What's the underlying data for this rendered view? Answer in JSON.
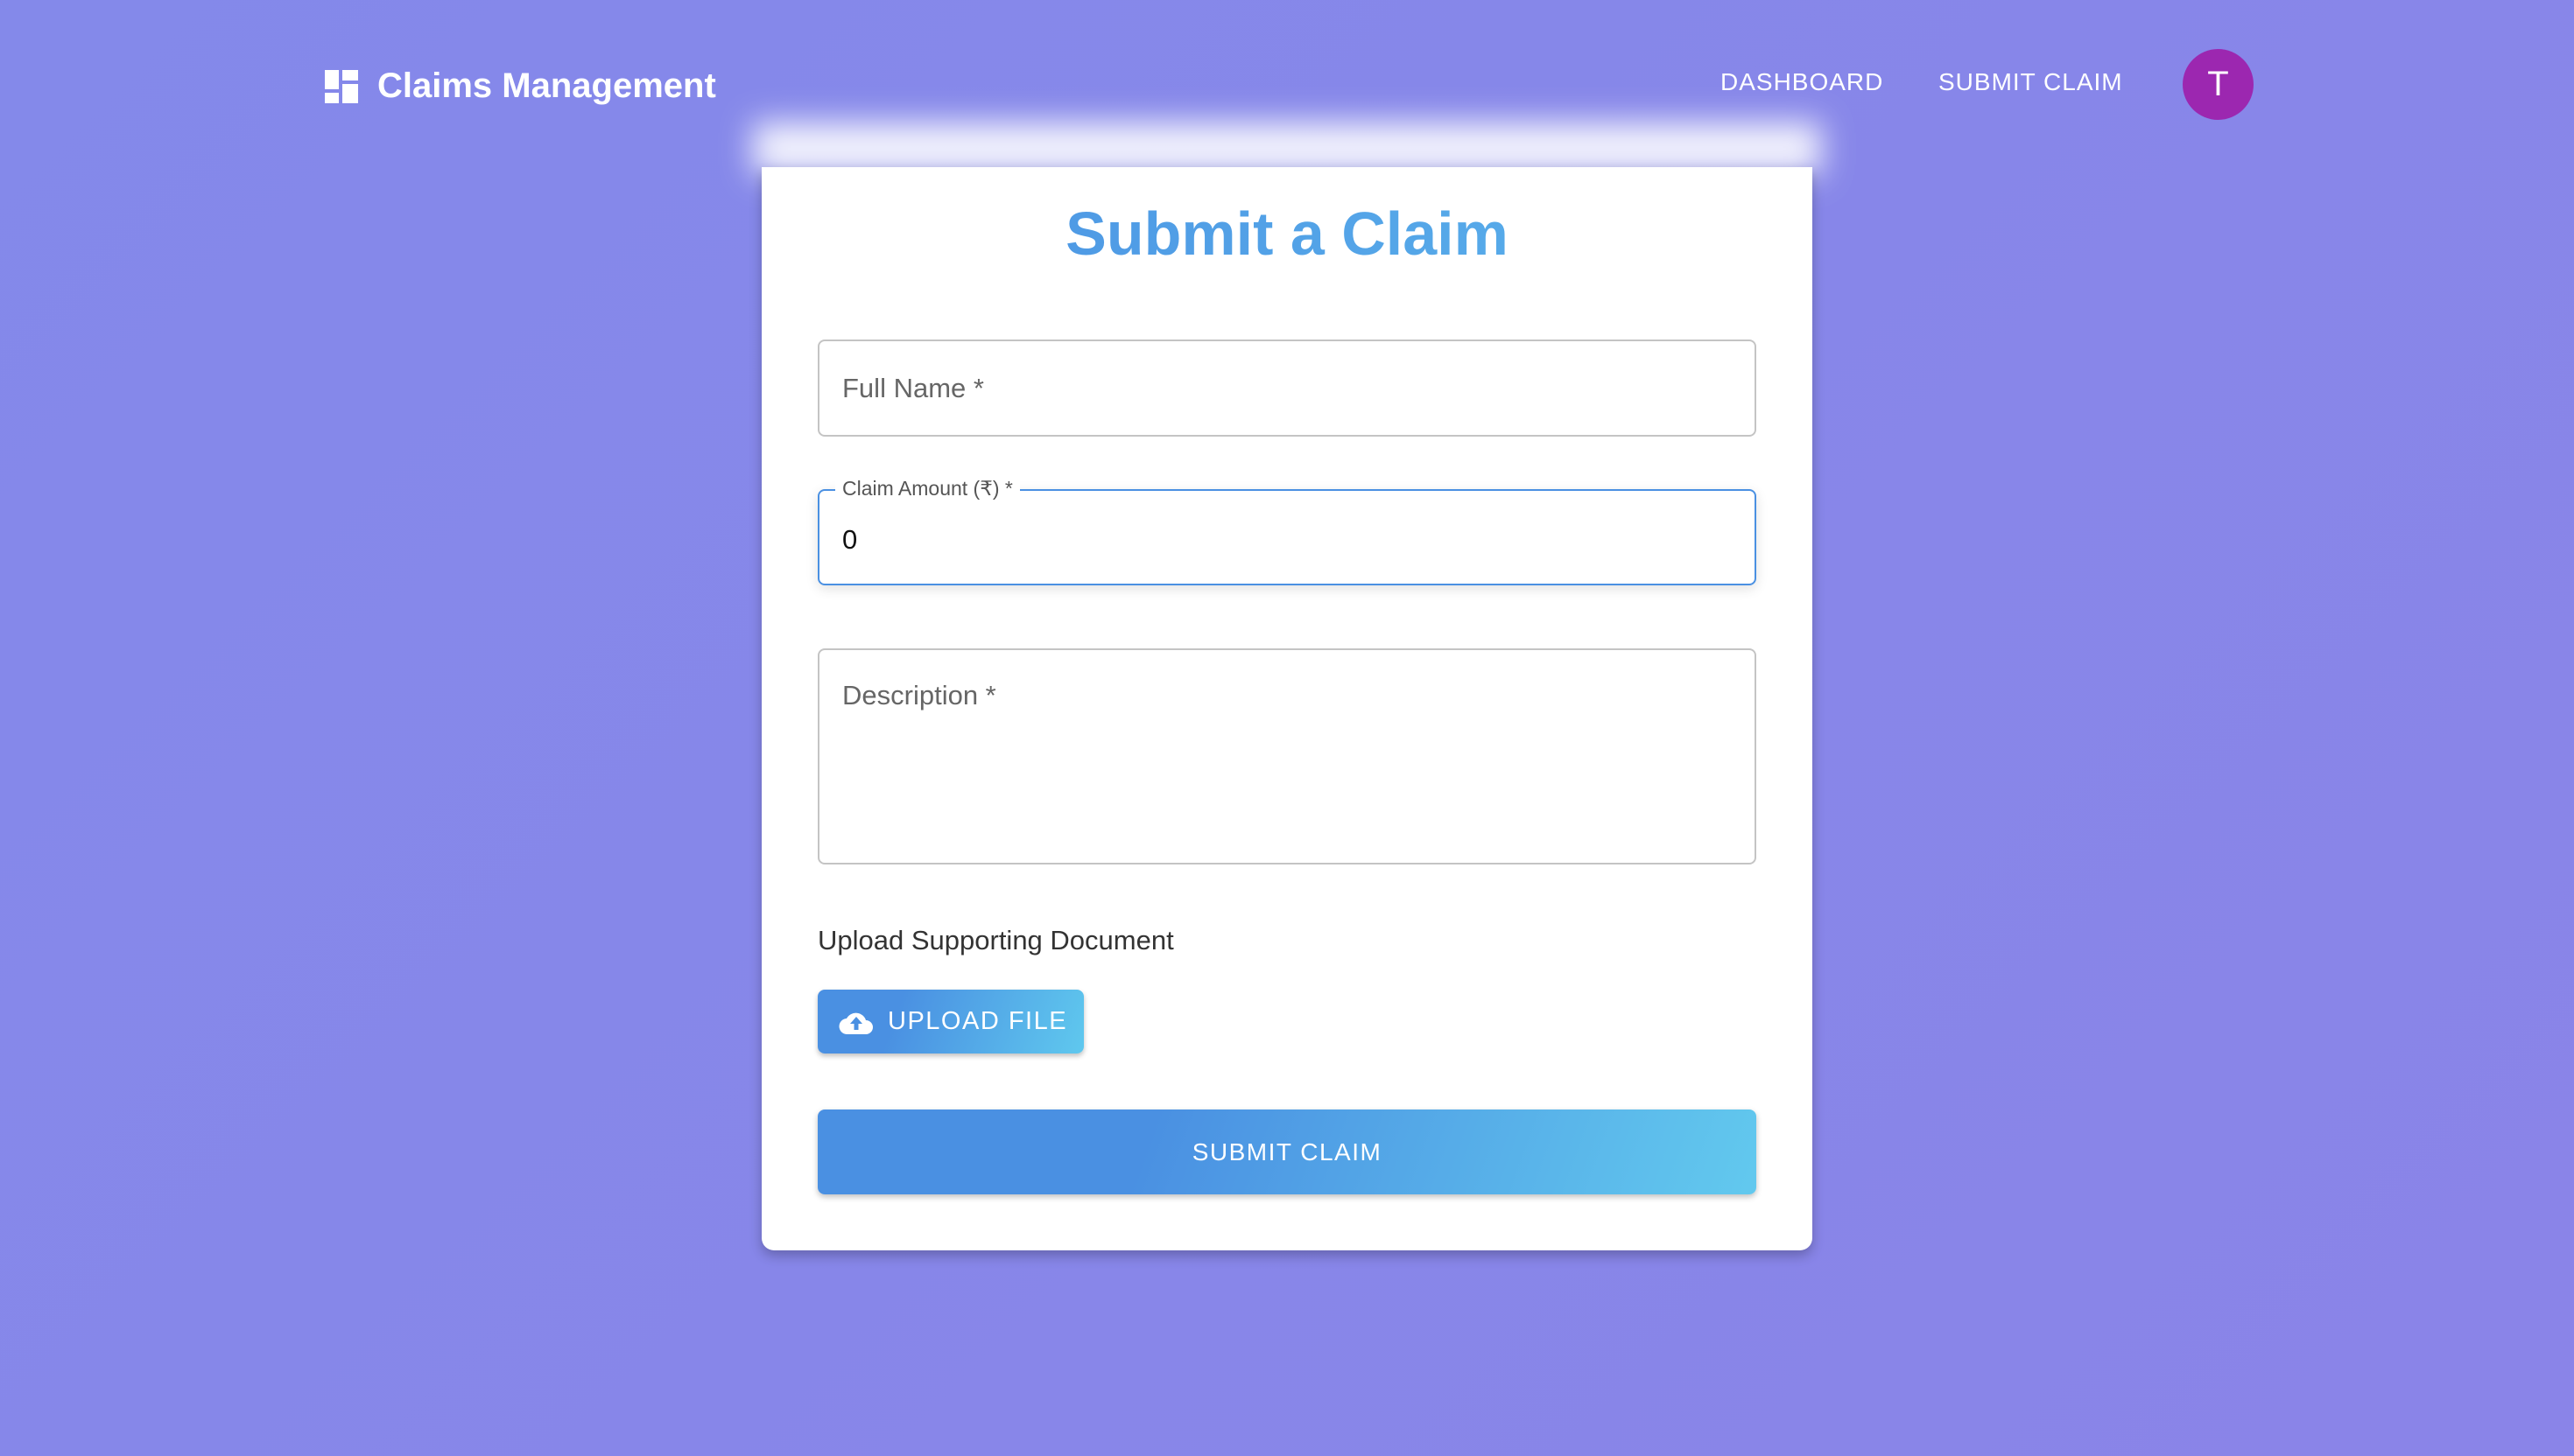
{
  "header": {
    "title": "Claims Management",
    "nav": [
      {
        "label": "DASHBOARD"
      },
      {
        "label": "SUBMIT CLAIM"
      }
    ],
    "avatar_initial": "T"
  },
  "form": {
    "title": "Submit a Claim",
    "full_name": {
      "placeholder": "Full Name *",
      "value": ""
    },
    "claim_amount": {
      "label": "Claim Amount (₹) *",
      "value": "0"
    },
    "description": {
      "placeholder": "Description *",
      "value": ""
    },
    "upload_label": "Upload Supporting Document",
    "upload_button": "UPLOAD FILE",
    "submit_button": "SUBMIT CLAIM"
  },
  "colors": {
    "accent": "#4a90e2",
    "background": "#8787ea",
    "avatar": "#9c27b0"
  }
}
